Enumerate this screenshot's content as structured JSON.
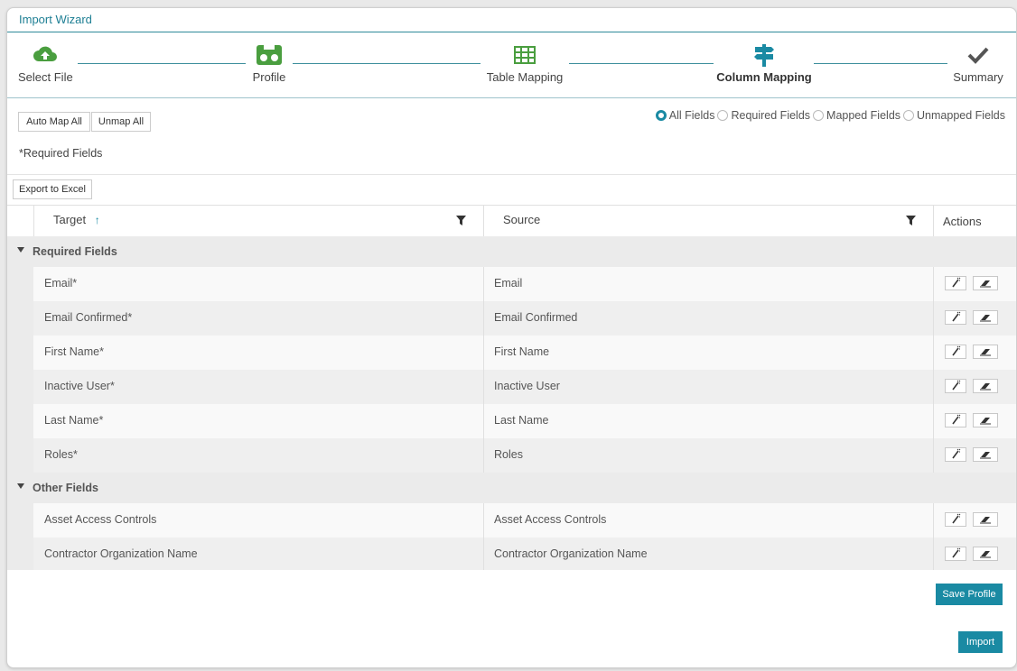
{
  "window": {
    "title": "Import Wizard"
  },
  "steps": [
    {
      "label": "Select File",
      "icon": "cloud-upload-icon",
      "color": "#4a9e3f"
    },
    {
      "label": "Profile",
      "icon": "cassette-icon",
      "color": "#4a9e3f"
    },
    {
      "label": "Table Mapping",
      "icon": "table-icon",
      "color": "#4a9e3f"
    },
    {
      "label": "Column Mapping",
      "icon": "signpost-icon",
      "color": "#1a8aa3",
      "active": true
    },
    {
      "label": "Summary",
      "icon": "checkmark-icon",
      "color": "#555555"
    }
  ],
  "toolbar": {
    "auto_map": "Auto Map All",
    "unmap_all": "Unmap All",
    "export": "Export to Excel"
  },
  "required_note": "*Required Fields",
  "filters": {
    "options": [
      "All Fields",
      "Required Fields",
      "Mapped Fields",
      "Unmapped Fields"
    ],
    "selected": "All Fields"
  },
  "grid": {
    "columns": {
      "target": "Target",
      "source": "Source",
      "actions": "Actions"
    },
    "sort": "ascending",
    "groups": [
      {
        "name": "Required Fields",
        "rows": [
          {
            "target": "Email*",
            "source": "Email"
          },
          {
            "target": "Email Confirmed*",
            "source": "Email Confirmed"
          },
          {
            "target": "First Name*",
            "source": "First Name"
          },
          {
            "target": "Inactive User*",
            "source": "Inactive User"
          },
          {
            "target": "Last Name*",
            "source": "Last Name"
          },
          {
            "target": "Roles*",
            "source": "Roles"
          }
        ]
      },
      {
        "name": "Other Fields",
        "rows": [
          {
            "target": "Asset Access Controls",
            "source": "Asset Access Controls"
          },
          {
            "target": "Contractor Organization Name",
            "source": "Contractor Organization Name"
          }
        ]
      }
    ]
  },
  "footer": {
    "save_profile": "Save Profile",
    "import": "Import"
  },
  "colors": {
    "accent": "#1a8aa3",
    "step_done": "#4a9e3f"
  }
}
